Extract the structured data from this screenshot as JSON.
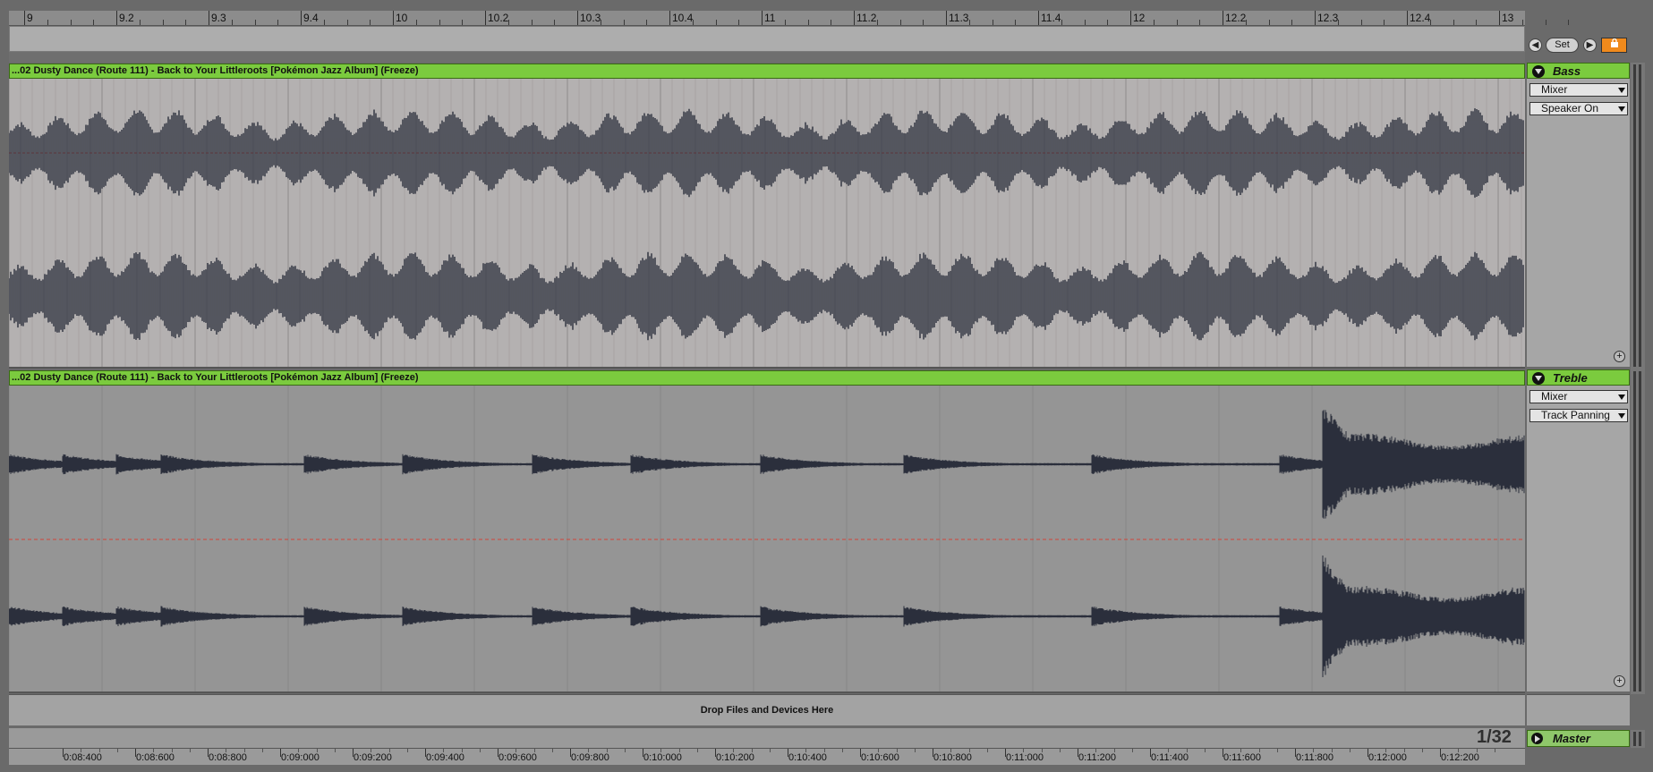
{
  "ruler": {
    "bar_labels": [
      "9",
      "9.2",
      "9.3",
      "9.4",
      "10",
      "10.2",
      "10.3",
      "10.4",
      "11",
      "11.2",
      "11.3",
      "11.4",
      "12",
      "12.2",
      "12.3",
      "12.4",
      "13"
    ]
  },
  "controls": {
    "set_label": "Set",
    "back_arrow": "◀",
    "forward_arrow": "▶"
  },
  "tracks": [
    {
      "clip_title": "...02 Dusty Dance (Route 111) - Back to Your Littleroots [Pokémon Jazz Album] (Freeze)",
      "name": "Bass",
      "device_chooser": "Mixer",
      "parameter_chooser": "Speaker On"
    },
    {
      "clip_title": "...02 Dusty Dance (Route 111) - Back to Your Littleroots [Pokémon Jazz Album] (Freeze)",
      "name": "Treble",
      "device_chooser": "Mixer",
      "parameter_chooser": "Track Panning"
    }
  ],
  "drop_zone": {
    "text": "Drop Files and Devices Here"
  },
  "master": {
    "name": "Master",
    "quantization": "1/32"
  },
  "time_ruler": {
    "labels": [
      "0:08:400",
      "0:08:600",
      "0:08:800",
      "0:09:000",
      "0:09:200",
      "0:09:400",
      "0:09:600",
      "0:09:800",
      "0:10:000",
      "0:10:200",
      "0:10:400",
      "0:10:600",
      "0:10:800",
      "0:11:000",
      "0:11:200",
      "0:11:400",
      "0:11:600",
      "0:11:800",
      "0:12:000",
      "0:12:200"
    ]
  },
  "colors": {
    "clip_green": "#7bcb3e",
    "waveform": "#2b2f3c",
    "automation_line": "#d0453a",
    "lock_orange": "#f08a1c"
  }
}
